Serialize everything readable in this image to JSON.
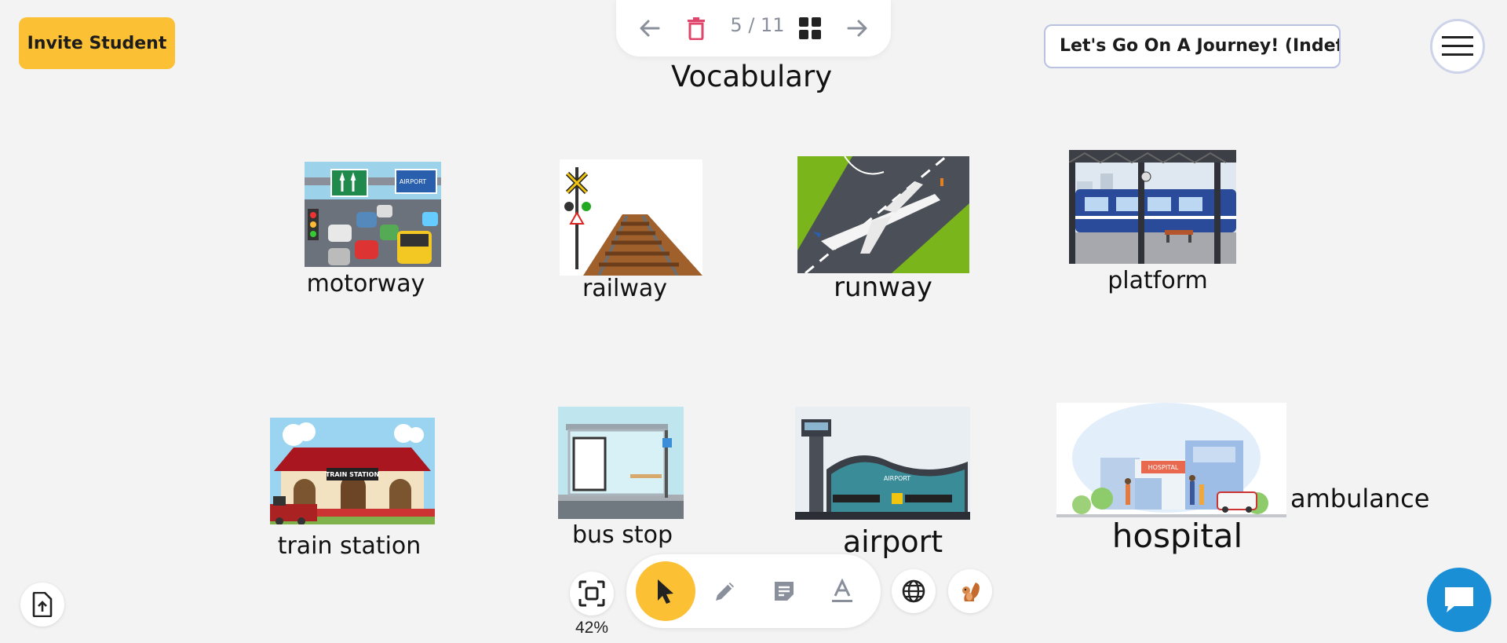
{
  "header": {
    "invite_label": "Invite Student",
    "page_indicator": "5 / 11",
    "lesson_title": "Let's Go On A Journey! (Indefinite Pronouns)",
    "slide_title": "Vocabulary"
  },
  "cards": [
    {
      "word": "motorway"
    },
    {
      "word": "railway"
    },
    {
      "word": "runway"
    },
    {
      "word": "platform"
    },
    {
      "word": "train station",
      "sign": "TRAIN STATION"
    },
    {
      "word": "bus stop"
    },
    {
      "word": "airport",
      "sign": "AIRPORT"
    },
    {
      "word": "hospital",
      "sign": "HOSPITAL"
    },
    {
      "word": "ambulance"
    }
  ],
  "motorway_sign": "AIRPORT",
  "toolbar": {
    "zoom": "42%",
    "tools": [
      "select-tool",
      "pen-tool",
      "sticky-note-tool",
      "text-tool"
    ],
    "active_tool": "select-tool"
  },
  "colors": {
    "accent": "#fcc035",
    "chat": "#1b8fd6",
    "delete": "#e0456b",
    "nav_arrow": "#8a8f9c"
  }
}
